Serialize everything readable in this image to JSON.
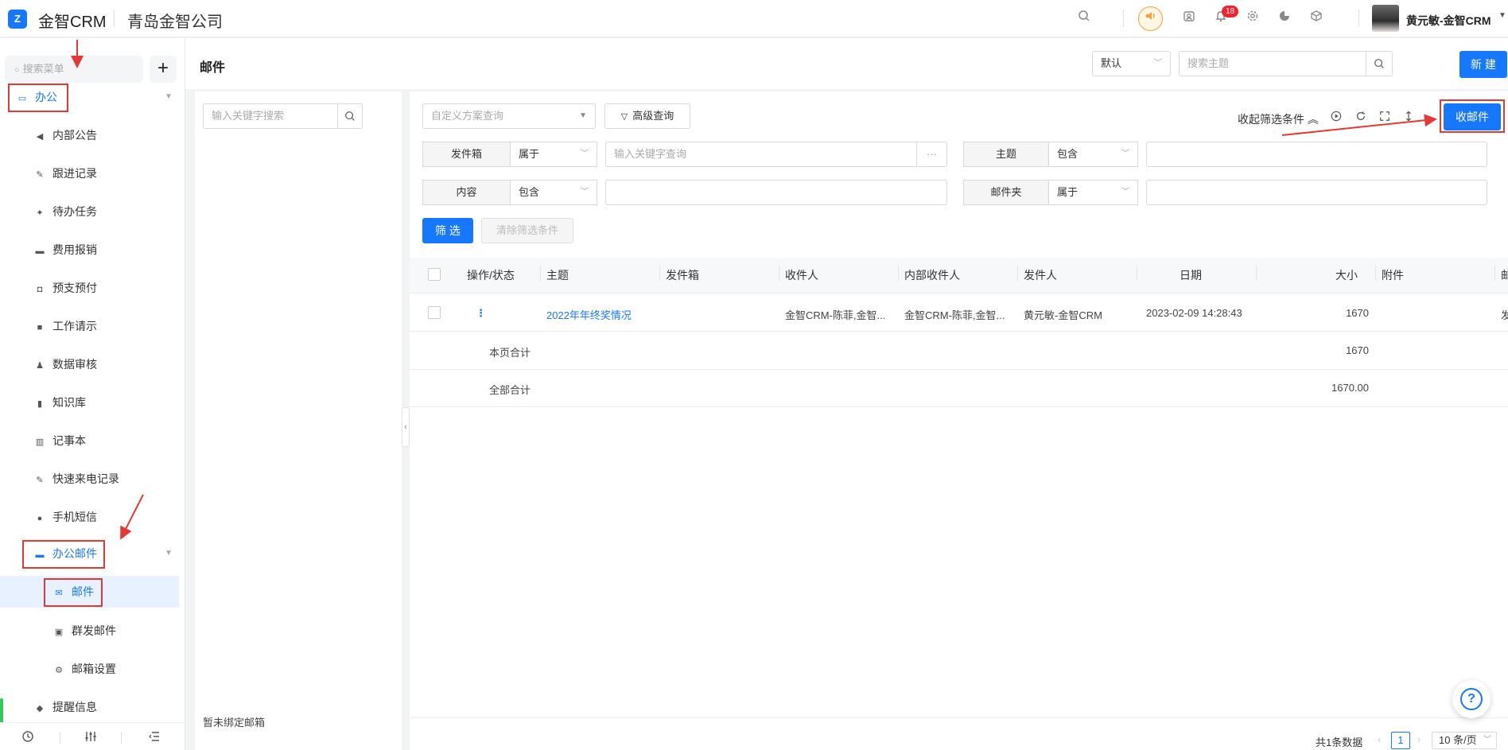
{
  "header": {
    "logo_text": "Z",
    "app_name": "金智CRM",
    "company": "青岛金智公司",
    "notification_count": "18",
    "username": "黄元敏-金智CRM",
    "icons": [
      "search-icon",
      "speaker-icon",
      "contacts-icon",
      "bell-icon",
      "gear-icon",
      "pie-chart-icon",
      "cube-icon"
    ]
  },
  "sidebar": {
    "search_placeholder": "搜索菜单",
    "add_label": "+",
    "group_office": "办公",
    "items": [
      {
        "label": "内部公告",
        "icon": "megaphone-icon"
      },
      {
        "label": "跟进记录",
        "icon": "edit-icon"
      },
      {
        "label": "待办任务",
        "icon": "pin-icon"
      },
      {
        "label": "费用报销",
        "icon": "card-icon"
      },
      {
        "label": "预支预付",
        "icon": "wallet-icon"
      },
      {
        "label": "工作请示",
        "icon": "message-icon"
      },
      {
        "label": "数据审核",
        "icon": "stamp-icon"
      },
      {
        "label": "知识库",
        "icon": "book-icon"
      },
      {
        "label": "记事本",
        "icon": "notebook-icon"
      },
      {
        "label": "快速来电记录",
        "icon": "edit-icon"
      },
      {
        "label": "手机短信",
        "icon": "chat-icon"
      }
    ],
    "group_mail": "办公邮件",
    "mail_items": [
      {
        "label": "邮件",
        "icon": "envelope-icon"
      },
      {
        "label": "群发邮件",
        "icon": "mass-mail-icon"
      },
      {
        "label": "邮箱设置",
        "icon": "settings-icon"
      }
    ],
    "reminder": "提醒信息"
  },
  "page": {
    "title": "邮件",
    "view_select": "默认",
    "topic_search_placeholder": "搜索主题",
    "new_button": "新 建"
  },
  "tree": {
    "search_placeholder": "输入关键字搜索",
    "empty_text": "暂未绑定邮箱"
  },
  "filters": {
    "scheme_placeholder": "自定义方案查询",
    "advanced_label": "高级查询",
    "collapse_label": "收起筛选条件",
    "receive_button": "收邮件",
    "rows": [
      {
        "label": "发件箱",
        "op": "属于",
        "placeholder": "输入关键字查询",
        "more": "···"
      },
      {
        "label": "主题",
        "op": "包含"
      },
      {
        "label": "内容",
        "op": "包含"
      },
      {
        "label": "邮件夹",
        "op": "属于"
      }
    ],
    "filter_button": "筛 选",
    "clear_button": "清除筛选条件"
  },
  "table": {
    "columns": [
      "操作/状态",
      "主题",
      "发件箱",
      "收件人",
      "内部收件人",
      "发件人",
      "日期",
      "大小",
      "附件",
      "邮"
    ],
    "rows": [
      {
        "action": "⋮",
        "subject": "2022年年终奖情况",
        "outbox": "",
        "recipient": "金智CRM-陈菲,金智...",
        "internal_recipient": "金智CRM-陈菲,金智...",
        "sender": "黄元敏-金智CRM",
        "date": "2023-02-09 14:28:43",
        "size": "1670",
        "attachment": "",
        "extra": "发"
      }
    ],
    "page_total_label": "本页合计",
    "page_total_value": "1670",
    "grand_total_label": "全部合计",
    "grand_total_value": "1670.00"
  },
  "pagination": {
    "total_text": "共1条数据",
    "current_page": "1",
    "page_size": "10 条/页"
  },
  "colors": {
    "primary": "#1677ff",
    "annotation_red": "#e53935",
    "badge_red": "#f5222d"
  }
}
